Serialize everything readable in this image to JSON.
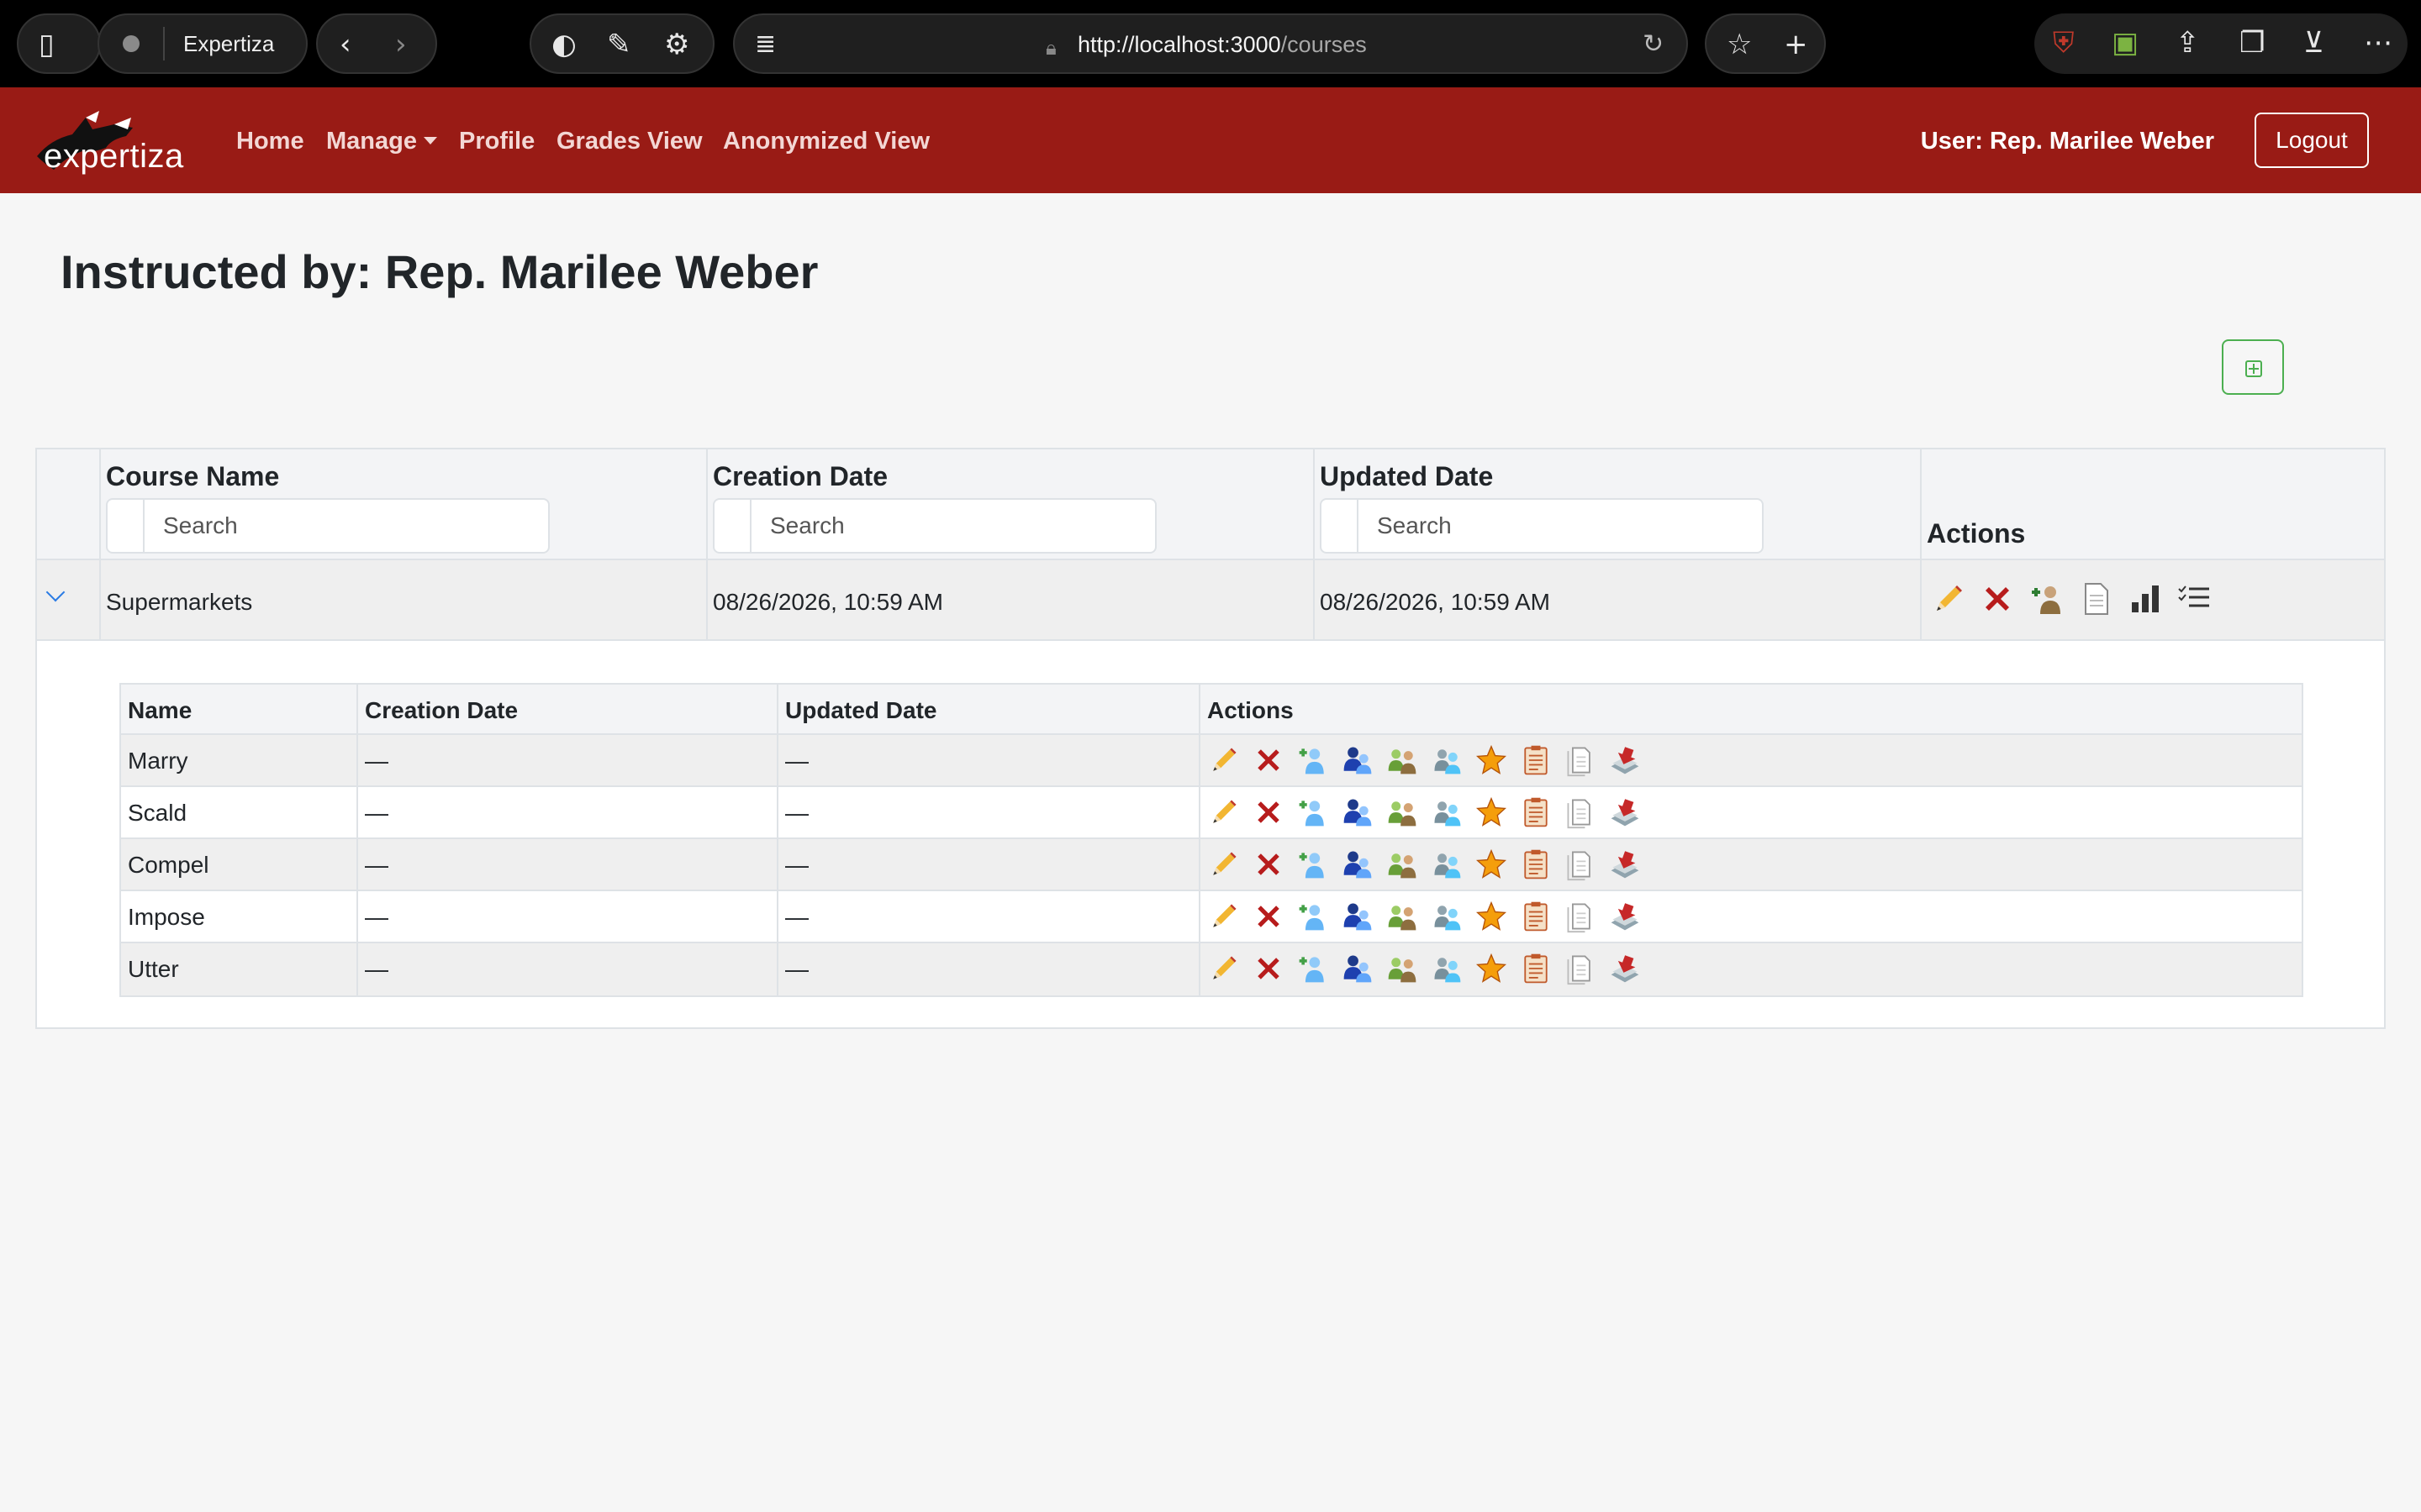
{
  "browser": {
    "tab_title": "Expertiza",
    "url_host": "http://localhost:3000",
    "url_path": "/courses"
  },
  "navbar": {
    "logo_text": "expertiza",
    "links": {
      "home": "Home",
      "manage": "Manage",
      "profile": "Profile",
      "grades_view": "Grades View",
      "anonymized_view": "Anonymized View"
    },
    "user_label": "User: Rep. Marilee Weber",
    "logout_label": "Logout"
  },
  "page": {
    "title": "Instructed by: Rep. Marilee Weber"
  },
  "courses_table": {
    "columns": {
      "name": "Course Name",
      "created": "Creation Date",
      "updated": "Updated Date",
      "actions": "Actions"
    },
    "search_placeholder": "Search",
    "rows": [
      {
        "name": "Supermarkets",
        "created": "08/26/2026, 10:59 AM",
        "updated": "08/26/2026, 10:59 AM",
        "actions": [
          "edit-icon",
          "delete-icon",
          "add-ta-icon",
          "copy-icon",
          "chart-icon",
          "list-icon"
        ]
      }
    ]
  },
  "assignments_table": {
    "columns": {
      "name": "Name",
      "created": "Creation Date",
      "updated": "Updated Date",
      "actions": "Actions"
    },
    "rows": [
      {
        "name": "Marry",
        "created": "—",
        "updated": "—"
      },
      {
        "name": "Scald",
        "created": "—",
        "updated": "—"
      },
      {
        "name": "Compel",
        "created": "—",
        "updated": "—"
      },
      {
        "name": "Impose",
        "created": "—",
        "updated": "—"
      },
      {
        "name": "Utter",
        "created": "—",
        "updated": "—"
      }
    ],
    "row_actions": [
      "edit-icon",
      "delete-icon",
      "add-participant-icon",
      "assign-reviewer-icon",
      "create-teams-icon",
      "view-reviews-icon",
      "scores-icon",
      "report-icon",
      "copy-icon",
      "publish-icon"
    ]
  },
  "colors": {
    "navbar": "#991b15",
    "accent_green": "#4caf50",
    "link_blue": "#2a7be4"
  }
}
